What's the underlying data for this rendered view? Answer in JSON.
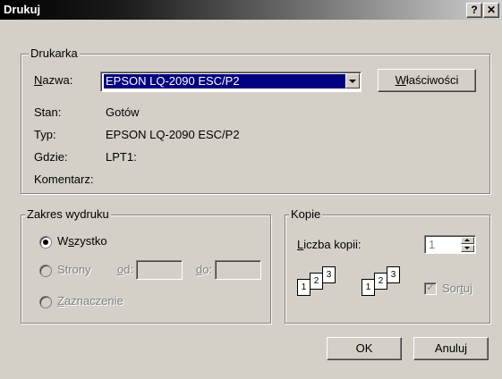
{
  "window": {
    "title": "Drukuj"
  },
  "titlebar": {
    "help_label": "?",
    "close_label": "✕"
  },
  "printer_group": {
    "legend": "Drukarka",
    "name_label_u": "N",
    "name_label_rest": "azwa:",
    "selected_printer": "EPSON LQ-2090 ESC/P2",
    "properties_u": "W",
    "properties_rest": "łaściwości",
    "status_label": "Stan:",
    "status_value": "Gotów",
    "type_label": "Typ:",
    "type_value": "EPSON LQ-2090 ESC/P2",
    "where_label": "Gdzie:",
    "where_value": "LPT1:",
    "comment_label": "Komentarz:",
    "comment_value": ""
  },
  "range_group": {
    "legend": "Zakres wydruku",
    "all_pre": "W",
    "all_u": "s",
    "all_rest": "zystko",
    "pages_label": "Strony",
    "from_u": "o",
    "from_rest": "d:",
    "to_u": "d",
    "to_rest": "o:",
    "selection_u": "Z",
    "selection_rest": "aznaczenie",
    "selected_option": "all"
  },
  "copies_group": {
    "legend": "Kopie",
    "count_u": "L",
    "count_rest": "iczba kopii:",
    "count_value": "1",
    "collate_pre": "Sor",
    "collate_u": "t",
    "collate_rest": "uj",
    "collate_checked": true,
    "collate_check_glyph": "✓",
    "page_numbers": [
      "1",
      "2",
      "3"
    ]
  },
  "buttons": {
    "ok": "OK",
    "cancel": "Anuluj"
  }
}
